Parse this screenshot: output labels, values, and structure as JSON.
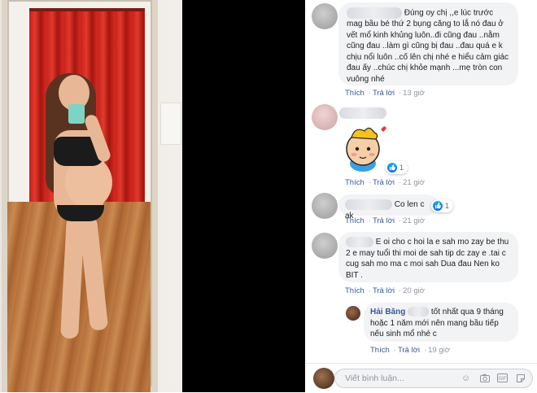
{
  "photo": {
    "description_name": "mirror-selfie-photo"
  },
  "comments": [
    {
      "text": "Đúng oy chị ,,e lúc trước mag bầu bé thứ 2 bụng căng to lắ nó đau ở vết mổ kinh khủng luôn..đi cũng đau ..nằm cũng đau ..làm gì cũng bị đau ..đau quá e k chịu nổi luôn ..cố lên chị nhé e hiểu cảm giác đau ấy ..chúc chị khỏe mạnh ...mẹ tròn con vuông nhé",
      "like": "Thích",
      "reply": "Trả lời",
      "time": "13 giờ"
    },
    {
      "text": "",
      "like": "Thích",
      "reply": "Trả lời",
      "time": "21 giờ",
      "reaction_count": "1"
    },
    {
      "text": "Co len c ak",
      "like": "Thích",
      "reply": "Trả lời",
      "time": "21 giờ",
      "reaction_count": "1"
    },
    {
      "text": "E oi cho c hoi la e sah mo zay be thu 2 e may tuổi thi moi de sah tip dc zay e .tai c cug sah mo ma c moi sah Dua đau Nen ko BIT .",
      "like": "Thích",
      "reply": "Trả lời",
      "time": "20 giờ"
    }
  ],
  "reply": {
    "author": "Hải Băng",
    "text": "tốt nhất qua 9 tháng hoặc 1 năm mới nên mang bầu tiếp nếu sinh mổ nhé c",
    "like": "Thích",
    "reply": "Trả lời",
    "time": "19 giờ"
  },
  "composer": {
    "placeholder": "Viết bình luận..."
  },
  "colors": {
    "link": "#385898",
    "bubble": "#f2f3f5",
    "muted": "#90949c"
  }
}
